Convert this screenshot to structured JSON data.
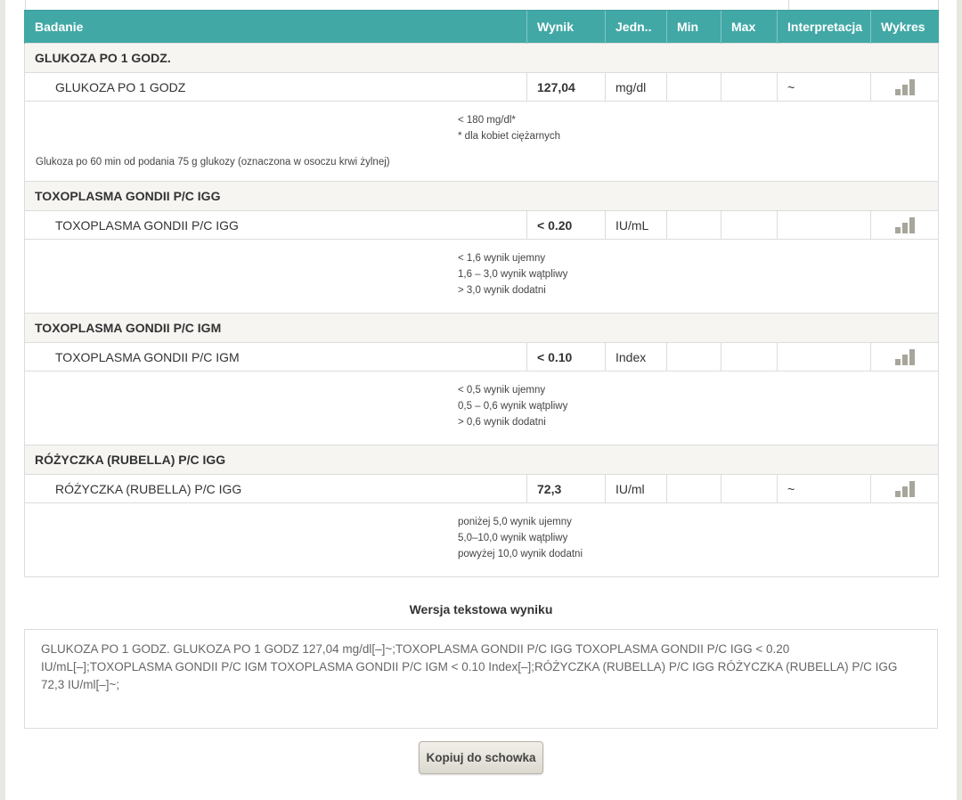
{
  "table": {
    "headers": {
      "test": "Badanie",
      "result": "Wynik",
      "unit": "Jedn..",
      "min": "Min",
      "max": "Max",
      "interpretation": "Interpretacja",
      "chart": "Wykres"
    },
    "groups": [
      {
        "title": "GLUKOZA PO 1 GODZ.",
        "item": {
          "name": "GLUKOZA PO 1 GODZ",
          "value": "127,04",
          "unit": "mg/dl",
          "min": "",
          "max": "",
          "interpretation": "~"
        },
        "ranges": [
          "< 180 mg/dl*",
          "* dla kobiet ciężarnych"
        ],
        "description": "Glukoza po 60 min od podania 75 g glukozy (oznaczona w osoczu krwi żylnej)"
      },
      {
        "title": "TOXOPLASMA GONDII P/C IGG",
        "item": {
          "name": "TOXOPLASMA GONDII P/C IGG",
          "value": "< 0.20",
          "unit": "IU/mL",
          "min": "",
          "max": "",
          "interpretation": ""
        },
        "ranges": [
          "< 1,6 wynik ujemny",
          "1,6 – 3,0 wynik wątpliwy",
          "> 3,0 wynik dodatni"
        ]
      },
      {
        "title": "TOXOPLASMA GONDII P/C IGM",
        "item": {
          "name": "TOXOPLASMA GONDII P/C IGM",
          "value": "< 0.10",
          "unit": "Index",
          "min": "",
          "max": "",
          "interpretation": ""
        },
        "ranges": [
          "< 0,5 wynik ujemny",
          "0,5 – 0,6 wynik wątpliwy",
          "> 0,6 wynik dodatni"
        ]
      },
      {
        "title": "RÓŻYCZKA (RUBELLA) P/C IGG",
        "item": {
          "name": "RÓŻYCZKA (RUBELLA) P/C IGG",
          "value": "72,3",
          "unit": "IU/ml",
          "min": "",
          "max": "",
          "interpretation": "~"
        },
        "ranges": [
          "poniżej 5,0 wynik ujemny",
          "5,0–10,0 wynik wątpliwy",
          "powyżej 10,0 wynik dodatni"
        ]
      }
    ]
  },
  "text_version": {
    "title": "Wersja tekstowa wyniku",
    "content": "GLUKOZA PO 1 GODZ. GLUKOZA PO 1 GODZ 127,04 mg/dl[–]~;TOXOPLASMA GONDII P/C IGG TOXOPLASMA GONDII P/C IGG < 0.20 IU/mL[–];TOXOPLASMA GONDII P/C IGM TOXOPLASMA GONDII P/C IGM < 0.10 Index[–];RÓŻYCZKA (RUBELLA) P/C IGG RÓŻYCZKA (RUBELLA) P/C IGG 72,3 IU/ml[–]~;"
  },
  "copy_button": {
    "label": "Kopiuj do schowka"
  },
  "icons": {
    "chart": "bar-chart-icon"
  },
  "colors": {
    "header_bg": "#41a8a6",
    "header_text": "#ffffff",
    "chart_icon": "#a8a59a"
  }
}
